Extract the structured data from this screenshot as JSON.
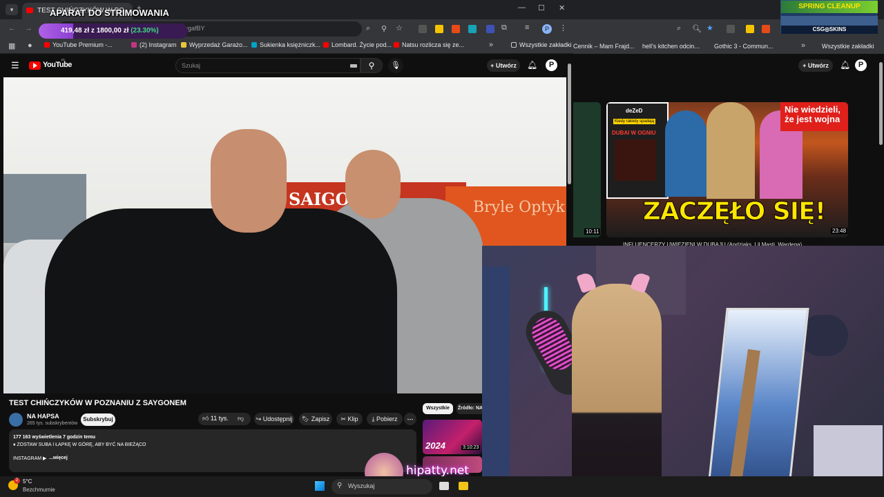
{
  "overlay": {
    "stream_title": "APARAT DO STRIMOWANIA",
    "goal_text": "419,48 zł z 1800,00 zł",
    "goal_percent": "(23.30%)",
    "goal_fraction": 0.233,
    "brand_tag": "SPRING CLEANUP",
    "brand_name": "CSG◎SKINS",
    "watermark": "hipatty.net"
  },
  "browser_left": {
    "tab_title": "TEST CHIŃCZYKÓW W PO...",
    "url_fragment": "hAggafBY",
    "bookmarks": [
      "YouTube Premium -...",
      "(2) Instagram",
      "Wyprzedaż Garażo...",
      "Sukienka księżniczk...",
      "Lombard. Życie pod...",
      "Natsu rozlicza się ze..."
    ],
    "all_bookmarks": "Wszystkie zakładki"
  },
  "youtube": {
    "logo_text": "YouTube",
    "country": "PL",
    "search_placeholder": "Szukaj",
    "create_label": "Utwórz",
    "avatar_letter": "P",
    "video_title": "TEST CHIŃCZYKÓW W POZNANIU Z SAYGONEM",
    "channel_name": "NA HAPSA",
    "subscribers": "265 tys. subskrybentów",
    "subscribe_label": "Subskrybuj",
    "likes": "11 tys.",
    "share_label": "Udostępnij",
    "save_label": "Zapisz",
    "clip_label": "Klip",
    "download_label": "Pobierz",
    "views_line": "177 163 wyświetlenia  7 godzin temu",
    "desc_line": "♦ ZOSTAW SUBA I ŁAPKĘ W GÓRĘ, ABY BYĆ NA BIEŻĄCO",
    "instagram_line": "INSTAGRAM ▶",
    "more_label": "...więcej",
    "chip_all": "Wszystkie",
    "chip_source": "Źródło: NA",
    "thumb_year": "2024",
    "thumb_duration": "3:10:23",
    "store_sign": "SAIGO",
    "shop_sign": "Bryle Optyk"
  },
  "browser_right": {
    "bookmarks": [
      "Cennik – Mam Frajd...",
      "hell's kitchen odcin...",
      "Gothic 3 - Commun..."
    ],
    "all_bookmarks": "Wszystkie zakładki",
    "create_label": "Utwórz",
    "avatar_letter": "P",
    "thumb_channel": "deZeD",
    "thumb_sub": "Kiedy rakiety spadają",
    "thumb_dubai": "DUBAI W OGNIU",
    "thumb_banner": "Nie wiedzieli, że jest wojna",
    "thumb_headline": "ZACZĘŁO SIĘ!",
    "thumb_duration": "23:48",
    "left_duration": "10:11",
    "video_title": "INFLUENCERZY UWIĘZIENI W DUBAJU (Andziaks, Lil Masti, Wardęga)"
  },
  "taskbar": {
    "weather_temp": "5°C",
    "weather_desc": "Bezchmurnie",
    "weather_badge": "2",
    "search_label": "Wyszukaj"
  },
  "colors": {
    "yt_red": "#ff0000",
    "overlay_purple": "#8a3fd1",
    "goal_green": "#3ddc84",
    "thumb_yellow": "#ffe600",
    "banner_red": "#e0201b"
  }
}
